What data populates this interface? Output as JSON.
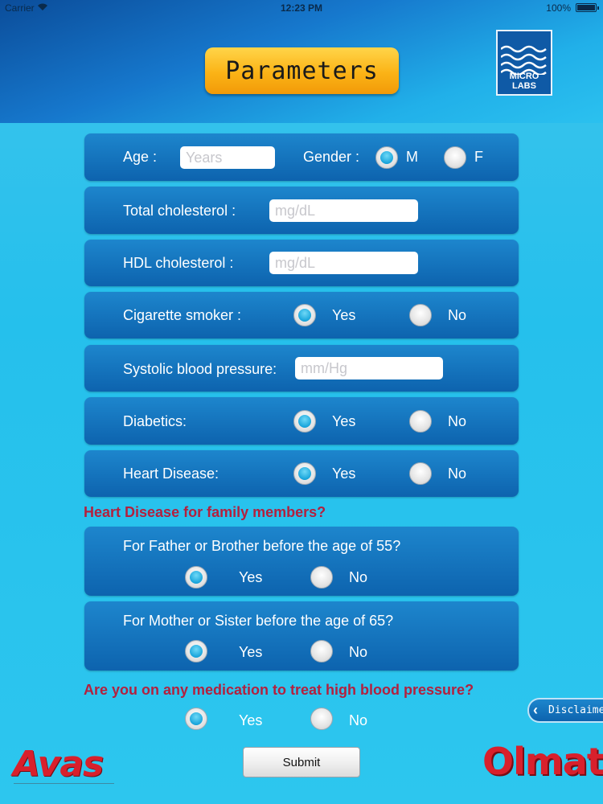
{
  "status_bar": {
    "carrier": "Carrier",
    "time": "12:23 PM",
    "battery": "100%",
    "wifi_icon": "wifi-icon",
    "battery_icon": "battery-icon"
  },
  "header": {
    "title": "Parameters",
    "logo_text": "MICRO LABS"
  },
  "form": {
    "age": {
      "label": "Age :",
      "placeholder": "Years",
      "value": ""
    },
    "gender": {
      "label": "Gender :",
      "options": [
        "M",
        "F"
      ],
      "selected": "M"
    },
    "total_cholesterol": {
      "label": "Total cholesterol :",
      "placeholder": "mg/dL",
      "value": ""
    },
    "hdl_cholesterol": {
      "label": "HDL cholesterol :",
      "placeholder": "mg/dL",
      "value": ""
    },
    "smoker": {
      "label": "Cigarette smoker :",
      "yes": "Yes",
      "no": "No",
      "selected": "Yes"
    },
    "systolic": {
      "label": "Systolic blood pressure:",
      "placeholder": "mm/Hg",
      "value": ""
    },
    "diabetics": {
      "label": "Diabetics:",
      "yes": "Yes",
      "no": "No",
      "selected": "Yes"
    },
    "heart_disease": {
      "label": "Heart Disease:",
      "yes": "Yes",
      "no": "No",
      "selected": "Yes"
    }
  },
  "family": {
    "heading": "Heart Disease for family members?",
    "father": {
      "label": "For Father or Brother before the age of 55?",
      "yes": "Yes",
      "no": "No",
      "selected": "Yes"
    },
    "mother": {
      "label": "For Mother or Sister before the age of 65?",
      "yes": "Yes",
      "no": "No",
      "selected": "Yes"
    }
  },
  "medication": {
    "heading": "Are you on any medication to treat high blood pressure?",
    "yes": "Yes",
    "no": "No",
    "selected": "Yes"
  },
  "disclaimer_label": "Disclaimer",
  "submit_label": "Submit",
  "brands": {
    "left": "Avas",
    "right": "Olmat"
  },
  "colors": {
    "accent_red": "#b3203e",
    "panel_blue": "#0d63ae",
    "title_orange": "#fbb316"
  }
}
